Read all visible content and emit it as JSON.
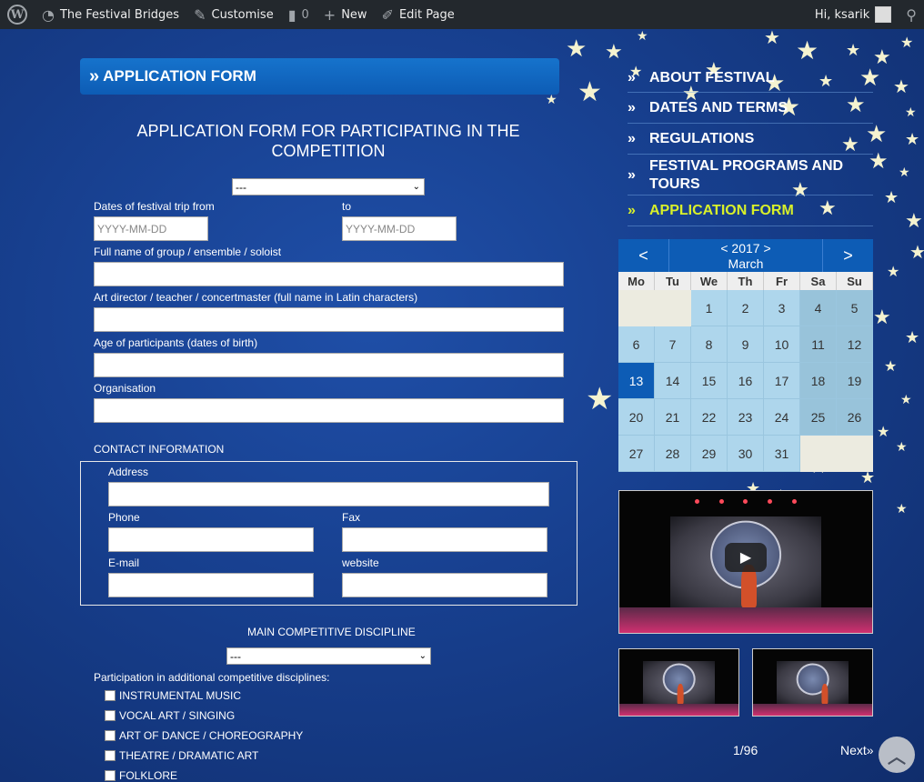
{
  "adminbar": {
    "site_name": "The Festival Bridges",
    "customise": "Customise",
    "comments_count": "0",
    "new": "New",
    "edit_page": "Edit Page",
    "greeting": "Hi, ksarik"
  },
  "section_title": "APPLICATION FORM",
  "form": {
    "heading": "APPLICATION FORM FOR PARTICIPATING IN THE COMPETITION",
    "top_select": "---",
    "dates_from_label": "Dates of festival trip from",
    "dates_to_label": "to",
    "date_placeholder": "YYYY-MM-DD",
    "group_label": "Full name of group / ensemble / soloist",
    "director_label": "Art director / teacher / concertmaster (full name in Latin characters)",
    "age_label": "Age of participants (dates of birth)",
    "organisation_label": "Organisation",
    "contact_heading": "CONTACT INFORMATION",
    "address_label": "Address",
    "phone_label": "Phone",
    "fax_label": "Fax",
    "email_label": "E-mail",
    "website_label": "website",
    "main_discipline_heading": "MAIN COMPETITIVE DISCIPLINE",
    "main_discipline_select": "---",
    "additional_label": "Participation in additional competitive disciplines:",
    "disciplines": [
      "INSTRUMENTAL MUSIC",
      "VOCAL ART / SINGING",
      "ART OF DANCE / CHOREOGRAPHY",
      "THEATRE / DRAMATIC ART",
      "FOLKLORE"
    ]
  },
  "menu": [
    {
      "label": "ABOUT FESTIVAL",
      "active": false
    },
    {
      "label": "DATES AND TERMS",
      "active": false
    },
    {
      "label": "REGULATIONS",
      "active": false
    },
    {
      "label": "FESTIVAL PROGRAMS AND TOURS",
      "active": false
    },
    {
      "label": "APPLICATION FORM",
      "active": true
    }
  ],
  "calendar": {
    "prev": "<",
    "next": ">",
    "year": "< 2017 >",
    "month": "March",
    "weekdays": [
      "Mo",
      "Tu",
      "We",
      "Th",
      "Fr",
      "Sa",
      "Su"
    ],
    "leading_blanks": 2,
    "days": 31,
    "today": 13
  },
  "gallery": {
    "counter": "1/96",
    "next": "Next»",
    "play_icon": "play-icon"
  },
  "colors": {
    "accent": "#0d5cb5",
    "active_menu": "#d8f02a"
  }
}
